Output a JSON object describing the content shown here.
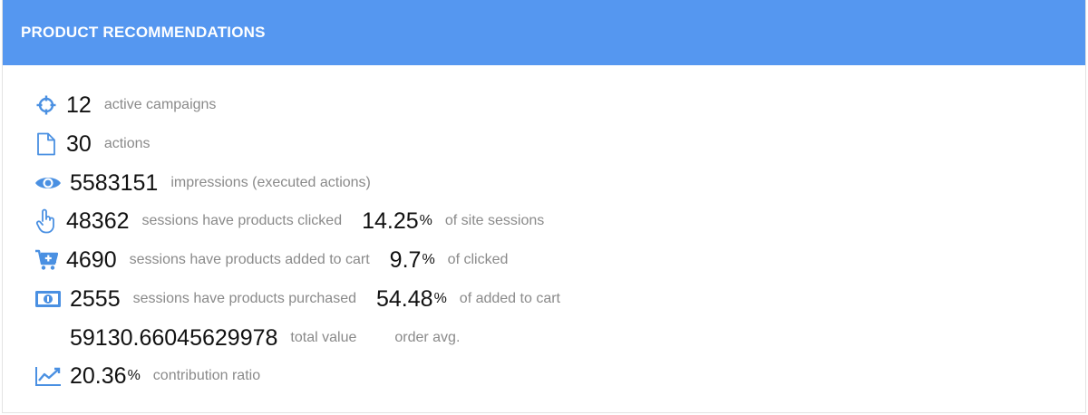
{
  "header": {
    "title": "PRODUCT RECOMMENDATIONS"
  },
  "accent_color": "#5597f0",
  "stats": {
    "active_campaigns": {
      "icon": "crosshair-icon",
      "value": "12",
      "label": "active campaigns"
    },
    "actions": {
      "icon": "file-icon",
      "value": "30",
      "label": "actions"
    },
    "impressions": {
      "icon": "eye-icon",
      "value": "5583151",
      "label": "impressions (executed actions)"
    },
    "clicked": {
      "icon": "hand-pointer-icon",
      "value": "48362",
      "label": "sessions have products clicked",
      "pct_value": "14.25",
      "pct_sign": "%",
      "pct_label": "of site sessions"
    },
    "added_to_cart": {
      "icon": "cart-plus-icon",
      "value": "4690",
      "label": "sessions have products added to cart",
      "pct_value": "9.7",
      "pct_sign": "%",
      "pct_label": "of clicked"
    },
    "purchased": {
      "icon": "money-bill-icon",
      "value": "2555",
      "label": "sessions have products purchased",
      "pct_value": "54.48",
      "pct_sign": "%",
      "pct_label": "of added to cart"
    },
    "total_value": {
      "value": "59130.66045629978",
      "label": "total value",
      "avg_label": "order avg."
    },
    "contribution": {
      "icon": "line-chart-icon",
      "pct_value": "20.36",
      "pct_sign": "%",
      "label": "contribution ratio"
    }
  }
}
